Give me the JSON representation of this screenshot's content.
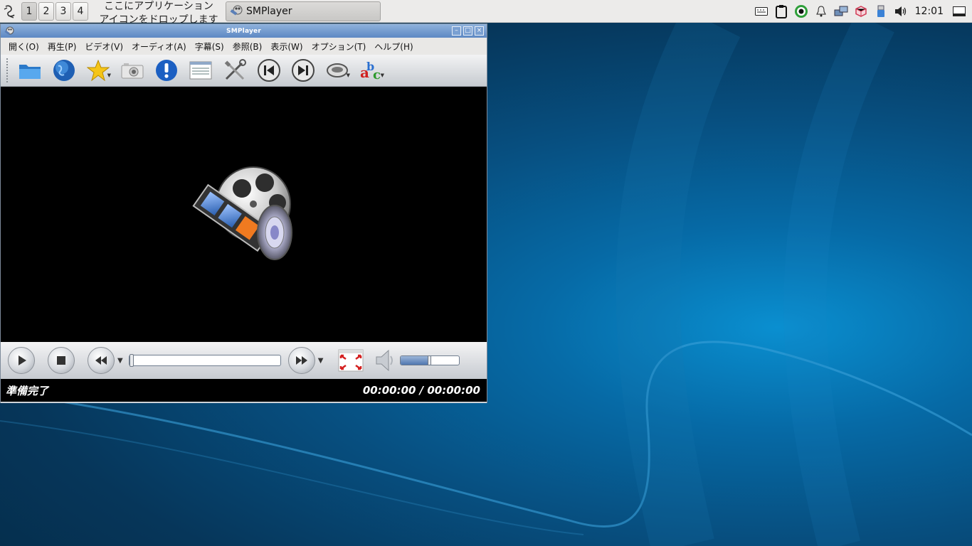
{
  "panel": {
    "workspaces": [
      "1",
      "2",
      "3",
      "4"
    ],
    "active_workspace": "1",
    "drop_hint_line1": "ここにアプリケーション",
    "drop_hint_line2": "アイコンをドロップします",
    "task_label": "SMPlayer",
    "clock": "12:01",
    "tray_icons": [
      "keyboard-icon",
      "clipboard-icon",
      "record-icon",
      "bell-icon",
      "network-icon",
      "package-icon",
      "usb-icon",
      "volume-icon",
      "show-desktop-icon"
    ]
  },
  "window": {
    "title": "SMPlayer",
    "menu": [
      "開く(O)",
      "再生(P)",
      "ビデオ(V)",
      "オーディオ(A)",
      "字幕(S)",
      "参照(B)",
      "表示(W)",
      "オプション(T)",
      "ヘルプ(H)"
    ],
    "toolbar_icons": [
      "open-folder-icon",
      "globe-icon",
      "favorites-star-icon",
      "screenshot-camera-icon",
      "info-icon",
      "playlist-icon",
      "preferences-tools-icon",
      "previous-icon",
      "next-icon",
      "audio-track-icon",
      "subtitle-icon"
    ],
    "status_text": "準備完了",
    "time_text": "00:00:00 / 00:00:00",
    "seek_position": 0.0,
    "volume_level": 0.5
  }
}
